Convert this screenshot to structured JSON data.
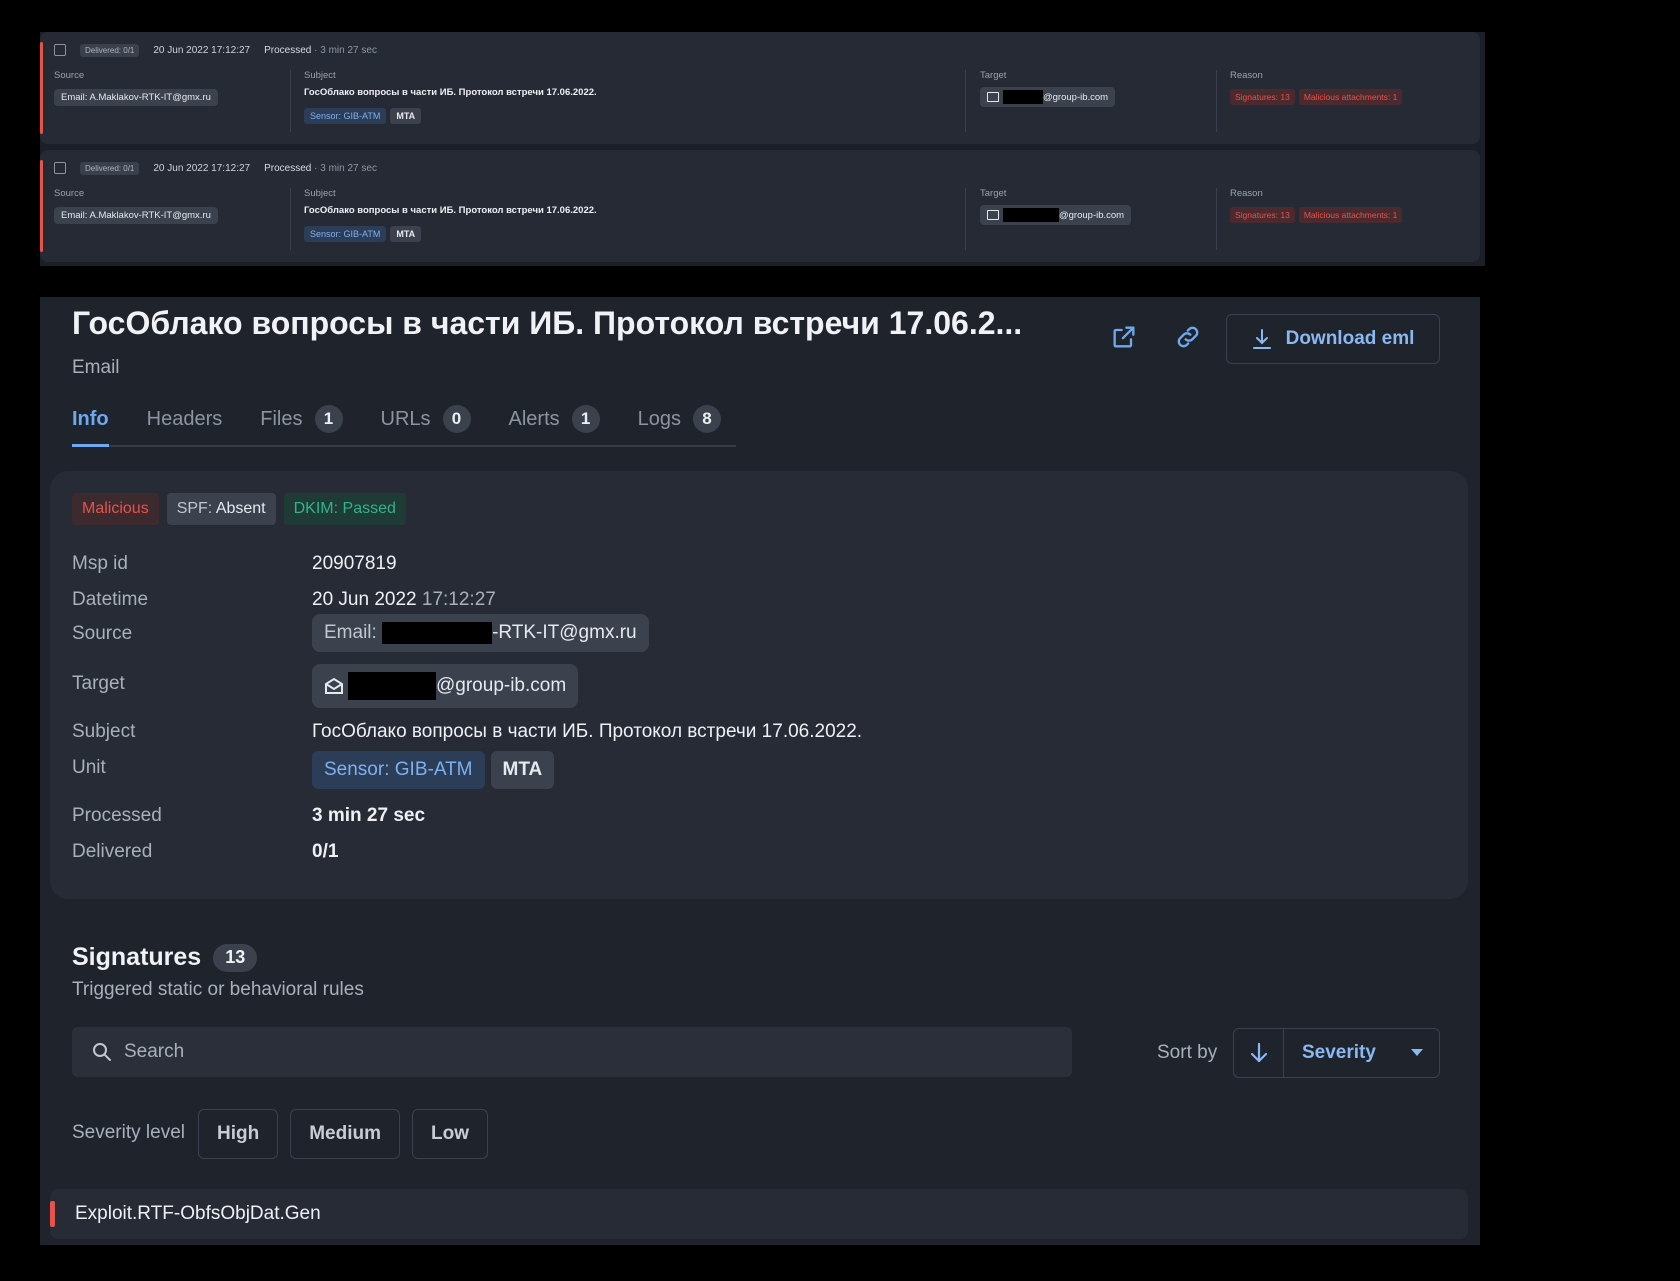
{
  "list": {
    "rows": [
      {
        "delivered": "Delivered: 0/1",
        "datetime": "20 Jun 2022 17:12:27",
        "processed_label": "Processed",
        "processed_value": "· 3 min 27 sec",
        "source_label": "Source",
        "source_value": "Email: A.Maklakov-RTK-IT@gmx.ru",
        "subject_label": "Subject",
        "subject_value": "ГосОблако вопросы в части ИБ. Протокол встречи 17.06.2022.",
        "sensor_tag": "Sensor: GIB-ATM",
        "mta_tag": "MTA",
        "target_label": "Target",
        "target_value": "@group-ib.com",
        "reason_label": "Reason",
        "reason_signatures": "Signatures: 13",
        "reason_attachments": "Malicious attachments: 1"
      },
      {
        "delivered": "Delivered: 0/1",
        "datetime": "20 Jun 2022 17:12:27",
        "processed_label": "Processed",
        "processed_value": "· 3 min 27 sec",
        "source_label": "Source",
        "source_value": "Email: A.Maklakov-RTK-IT@gmx.ru",
        "subject_label": "Subject",
        "subject_value": "ГосОблако вопросы в части ИБ. Протокол встречи 17.06.2022.",
        "sensor_tag": "Sensor: GIB-ATM",
        "mta_tag": "MTA",
        "target_label": "Target",
        "target_value": "@group-ib.com",
        "reason_label": "Reason",
        "reason_signatures": "Signatures: 13",
        "reason_attachments": "Malicious attachments: 1"
      }
    ]
  },
  "detail": {
    "title": "ГосОблако вопросы в части ИБ. Протокол встречи 17.06.2...",
    "subtitle": "Email",
    "download_label": "Download eml",
    "tabs": [
      {
        "label": "Info",
        "count": ""
      },
      {
        "label": "Headers",
        "count": ""
      },
      {
        "label": "Files",
        "count": "1"
      },
      {
        "label": "URLs",
        "count": "0"
      },
      {
        "label": "Alerts",
        "count": "1"
      },
      {
        "label": "Logs",
        "count": "8"
      }
    ],
    "badges": {
      "malicious": "Malicious",
      "spf_label": "SPF:",
      "spf_value": "Absent",
      "dkim": "DKIM: Passed"
    },
    "fields": {
      "msp_id_label": "Msp id",
      "msp_id_value": "20907819",
      "datetime_label": "Datetime",
      "datetime_date": "20 Jun 2022",
      "datetime_time": "17:12:27",
      "source_label": "Source",
      "source_prefix": "Email:",
      "source_suffix": "-RTK-IT@gmx.ru",
      "target_label": "Target",
      "target_suffix": "@group-ib.com",
      "subject_label": "Subject",
      "subject_value": "ГосОблако вопросы в части ИБ. Протокол встречи 17.06.2022.",
      "unit_label": "Unit",
      "unit_sensor": "Sensor: GIB-ATM",
      "unit_mta": "MTA",
      "processed_label": "Processed",
      "processed_value": "3 min 27 sec",
      "delivered_label": "Delivered",
      "delivered_value": "0/1"
    },
    "signatures": {
      "title": "Signatures",
      "count": "13",
      "subtitle": "Triggered static or behavioral rules",
      "search_placeholder": "Search",
      "sort_label": "Sort by",
      "sort_value": "Severity",
      "severity_label": "Severity level",
      "severity_high": "High",
      "severity_medium": "Medium",
      "severity_low": "Low",
      "first_item": "Exploit.RTF-ObfsObjDat.Gen"
    }
  },
  "colors": {
    "accent": "#6ea8f0",
    "danger": "#e5534b",
    "success": "#2fb489"
  }
}
